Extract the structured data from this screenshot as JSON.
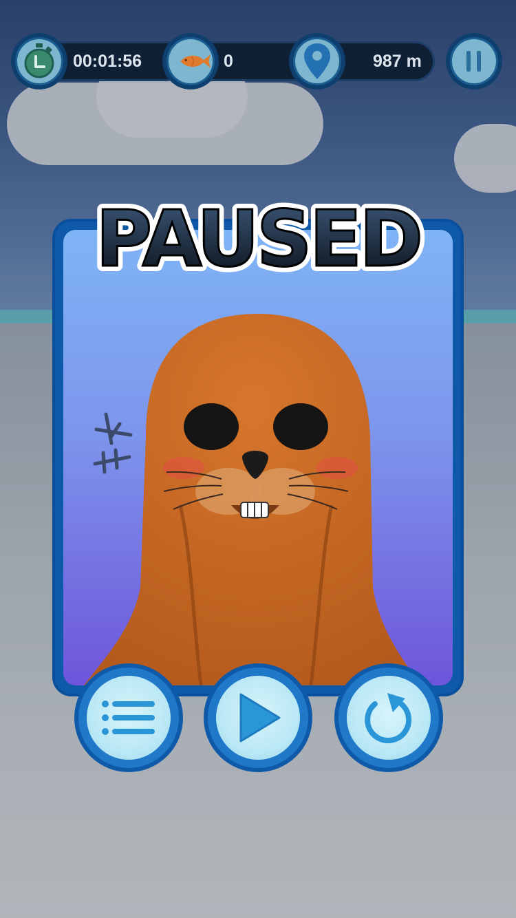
{
  "hud": {
    "timer": "00:01:56",
    "fish_count": "0",
    "distance": "987 m",
    "icons": [
      "stopwatch-icon",
      "fish-icon",
      "location-pin-icon",
      "pause-icon"
    ]
  },
  "pause_panel": {
    "title": "PAUSED",
    "character": "seal-mascot"
  },
  "buttons": {
    "menu_icon": "list-menu-icon",
    "resume_icon": "play-icon",
    "restart_icon": "restart-icon"
  },
  "colors": {
    "hud_bar": "#0f2034",
    "hud_circle": "#1a5e92",
    "panel_border": "#0f5aa8",
    "panel_top": "#7fb4f5",
    "panel_bottom": "#6e55da",
    "seal": "#c96b25",
    "button_face": "#bbe8f5",
    "button_icon": "#2a96d8"
  }
}
